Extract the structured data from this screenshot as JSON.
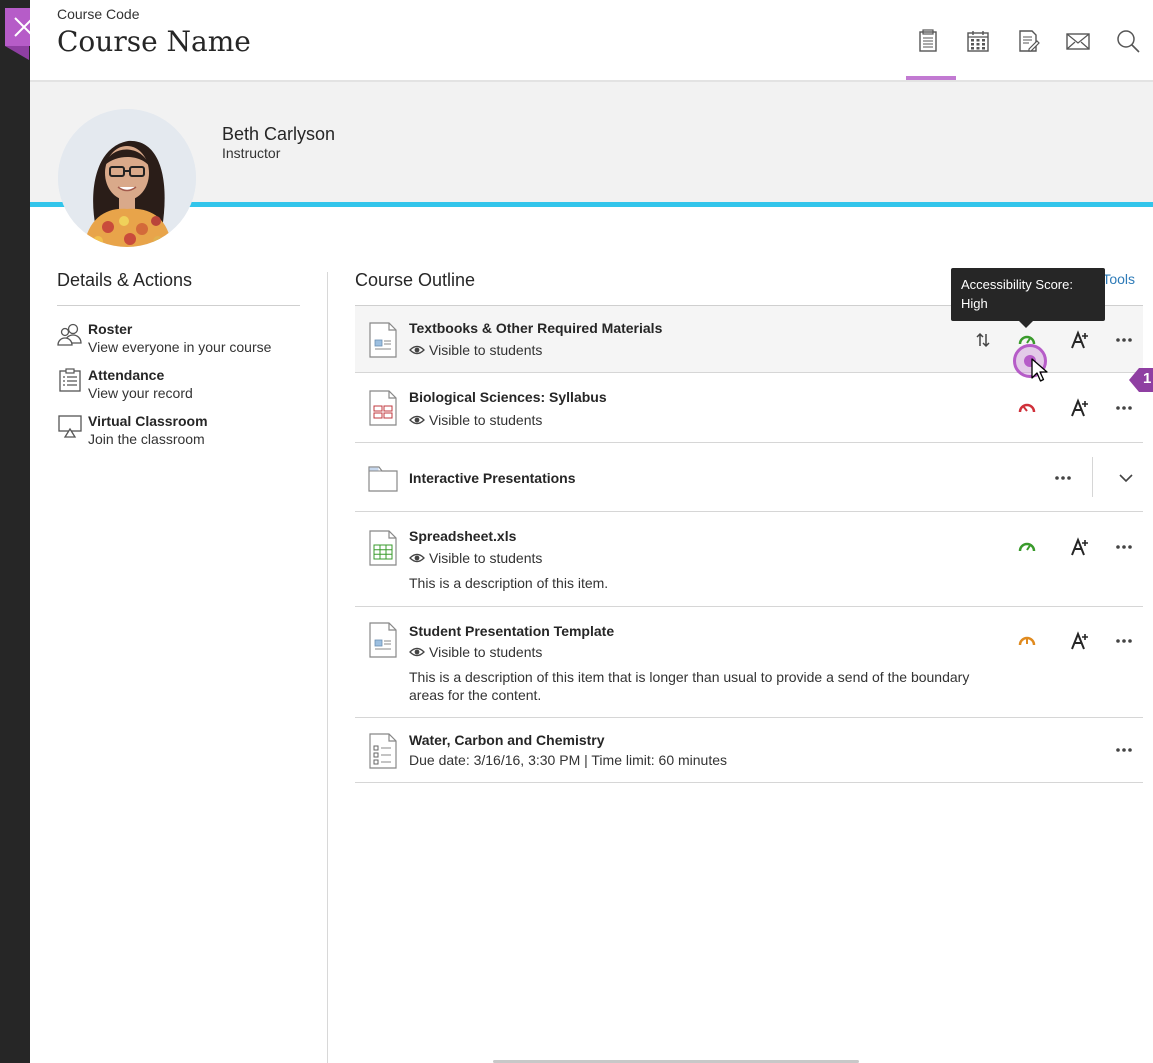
{
  "header": {
    "course_code": "Course Code",
    "course_name": "Course Name"
  },
  "instructor": {
    "name": "Beth Carlyson",
    "role": "Instructor"
  },
  "details": {
    "title": "Details & Actions",
    "items": [
      {
        "label": "Roster",
        "sub": "View everyone in your course",
        "icon": "roster-icon"
      },
      {
        "label": "Attendance",
        "sub": "View your record",
        "icon": "attendance-icon"
      },
      {
        "label": "Virtual Classroom",
        "sub": "Join the classroom",
        "icon": "virtual-classroom-icon"
      }
    ]
  },
  "outline": {
    "title": "Course Outline",
    "tools_link": "Tools",
    "tooltip": "Accessibility Score: High",
    "badge_number": "1",
    "items": [
      {
        "title": "Textbooks & Other Required Materials",
        "visibility": "Visible to students",
        "score": "high",
        "score_color": "#3a9b2c"
      },
      {
        "title": "Biological Sciences: Syllabus",
        "visibility": "Visible to students",
        "score": "low",
        "score_color": "#d0303a"
      },
      {
        "title": "Interactive Presentations"
      },
      {
        "title": "Spreadsheet.xls",
        "visibility": "Visible to students",
        "description": "This is a description of this item.",
        "score": "high",
        "score_color": "#3a9b2c"
      },
      {
        "title": "Student Presentation Template",
        "visibility": "Visible to students",
        "description": "This is a description of this item that is longer than usual to provide a send of the boundary areas for the content.",
        "score": "medium",
        "score_color": "#e08a1e"
      },
      {
        "title": "Water, Carbon and Chemistry",
        "meta": "Due date: 3/16/16, 3:30 PM | Time limit: 60 minutes"
      }
    ]
  },
  "colors": {
    "accent": "#b65cc8",
    "banner_line": "#32c5eb",
    "link": "#2e7bb8"
  }
}
